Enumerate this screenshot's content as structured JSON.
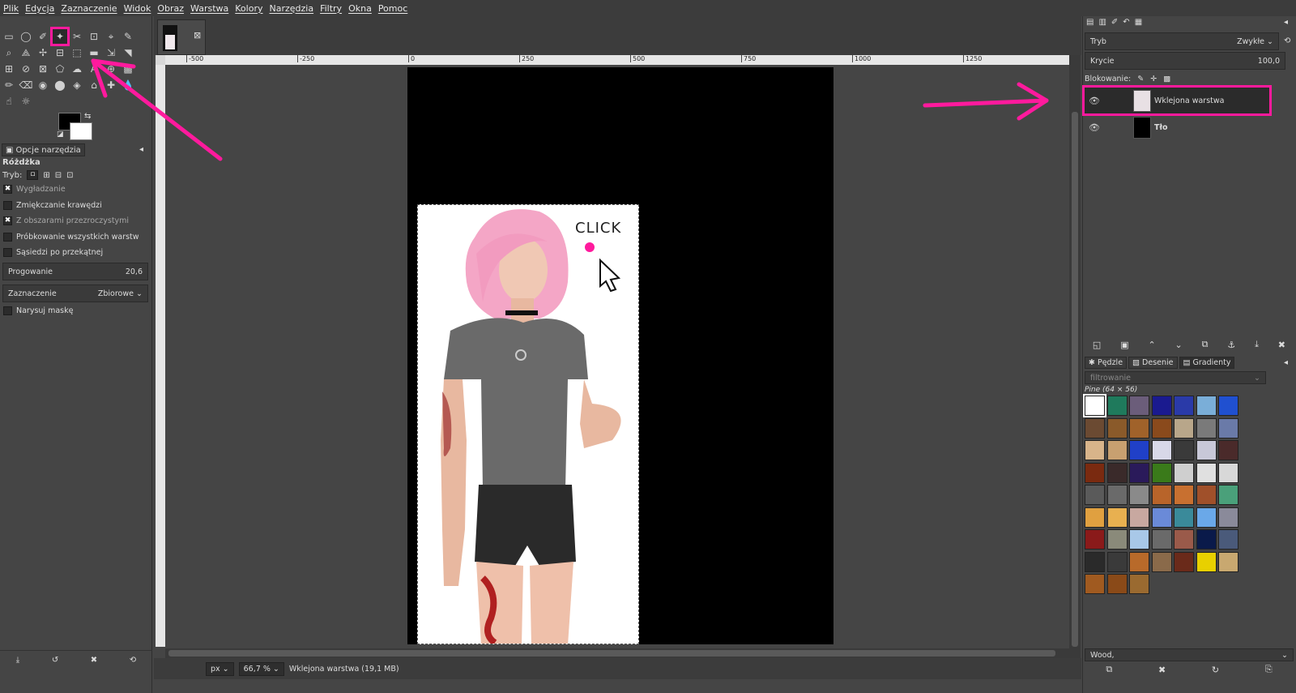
{
  "menubar": [
    "Plik",
    "Edycja",
    "Zaznaczenie",
    "Widok",
    "Obraz",
    "Warstwa",
    "Kolory",
    "Narzędzia",
    "Filtry",
    "Okna",
    "Pomoc"
  ],
  "tool_options": {
    "tab_label": "Opcje narzędzia",
    "tool_name": "Różdżka",
    "mode_label": "Tryb:",
    "options": [
      {
        "label": "Wygładzanie",
        "checked": true
      },
      {
        "label": "Zmiękczanie krawędzi",
        "checked": false
      },
      {
        "label": "Z obszarami przezroczystymi",
        "checked": true
      },
      {
        "label": "Próbkowanie wszystkich warstw",
        "checked": false
      },
      {
        "label": "Sąsiedzi po przekątnej",
        "checked": false
      }
    ],
    "threshold_label": "Progowanie",
    "threshold_value": "20,6",
    "selection_label": "Zaznaczenie",
    "selection_value": "Zbiorowe",
    "draw_mask_label": "Narysuj maskę"
  },
  "ruler": {
    "ticks": [
      "-500",
      "-250",
      "0",
      "250",
      "500",
      "750",
      "1000",
      "1250"
    ]
  },
  "canvas": {
    "image_text": "CLICK"
  },
  "status": {
    "unit": "px",
    "zoom": "66,7 %",
    "info": "Wklejona warstwa (19,1 MB)"
  },
  "layers": {
    "mode_label": "Tryb",
    "mode_value": "Zwykłe",
    "opacity_label": "Krycie",
    "opacity_value": "100,0",
    "lock_label": "Blokowanie:",
    "items": [
      {
        "name": "Wklejona warstwa",
        "selected": true
      },
      {
        "name": "Tło",
        "selected": false
      }
    ]
  },
  "patterns": {
    "tabs": [
      "Pędzle",
      "Desenie",
      "Gradienty"
    ],
    "filter_placeholder": "filtrowanie",
    "pattern_title": "Pine (64 × 56)",
    "selected_name": "Wood,",
    "colors": [
      "#ffffff",
      "#1f7a5c",
      "#6b5d7a",
      "#1a1a8f",
      "#2a3aa8",
      "#7aaed8",
      "#2050d0",
      "#6b4a32",
      "#8a5a2a",
      "#a0622a",
      "#8a4a1c",
      "#b8a68a",
      "#7a7a7a",
      "#6a7aa8",
      "#d8b48a",
      "#c8a070",
      "#2040c8",
      "#d8d8e8",
      "#3a3a3a",
      "#c8c8d8",
      "#4a2a2a",
      "#7a2a10",
      "#3a2a2a",
      "#2a1a5a",
      "#3a7a1a",
      "#cfcfcf",
      "#e0e0e0",
      "#d8d8d8",
      "#5a5a5a",
      "#6a6a6a",
      "#8a8a8a",
      "#b8642a",
      "#c87030",
      "#a0502a",
      "#4aa07a",
      "#e0a040",
      "#e8b050",
      "#c8a8a0",
      "#6a8ad8",
      "#3a8a9a",
      "#6aa8e8",
      "#8a8a9a",
      "#8a1a1a",
      "#8a8a7a",
      "#a8c8e8",
      "#6a6a6a",
      "#9a5a4a",
      "#0a1a4a",
      "#4a5a7a",
      "#2a2a2a",
      "#3a3a3a",
      "#b86a2a",
      "#8a6a4a",
      "#6a2a1a",
      "#e8d000",
      "#c8a870",
      "#a05a20",
      "#8a4a18",
      "#9a6a30"
    ]
  },
  "colors": {
    "accent": "#ff1a9d",
    "bg": "#454545",
    "panel": "#3c3c3c"
  }
}
